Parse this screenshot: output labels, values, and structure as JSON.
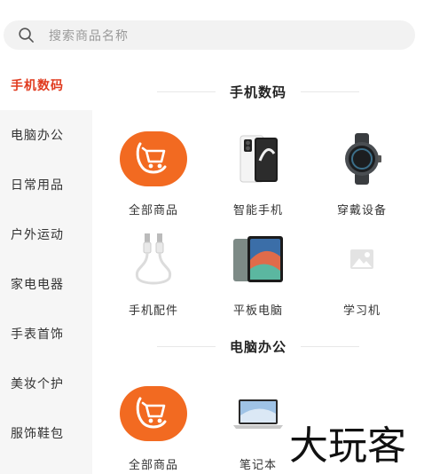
{
  "search": {
    "placeholder": "搜索商品名称",
    "icon": "search-icon"
  },
  "sidebar": {
    "items": [
      {
        "label": "手机数码",
        "active": true
      },
      {
        "label": "电脑办公"
      },
      {
        "label": "日常用品"
      },
      {
        "label": "户外运动"
      },
      {
        "label": "家电电器"
      },
      {
        "label": "手表首饰"
      },
      {
        "label": "美妆个护"
      },
      {
        "label": "服饰鞋包"
      }
    ]
  },
  "sections": [
    {
      "title": "手机数码",
      "items": [
        {
          "label": "全部商品",
          "icon": "shopping-cart-icon"
        },
        {
          "label": "智能手机",
          "icon": "smartphone-image"
        },
        {
          "label": "穿戴设备",
          "icon": "smartwatch-image"
        },
        {
          "label": "手机配件",
          "icon": "usb-cable-image"
        },
        {
          "label": "平板电脑",
          "icon": "tablet-image"
        },
        {
          "label": "学习机",
          "icon": "image-placeholder-icon"
        }
      ]
    },
    {
      "title": "电脑办公",
      "items": [
        {
          "label": "全部商品",
          "icon": "shopping-cart-icon"
        },
        {
          "label": "笔记本",
          "icon": "laptop-image"
        }
      ]
    }
  ],
  "watermark": {
    "text": "大玩客"
  },
  "colors": {
    "accent": "#e03a1e",
    "orange": "#f26a21",
    "sidebar_bg": "#f6f6f6"
  }
}
